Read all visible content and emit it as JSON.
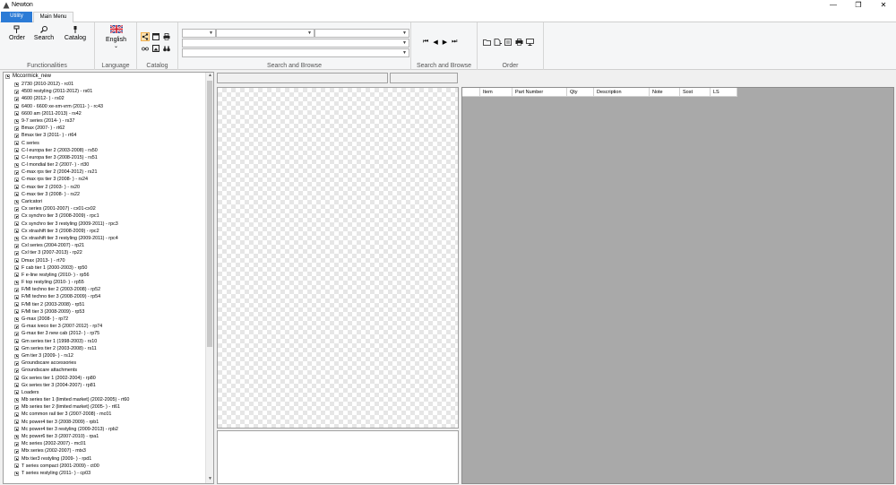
{
  "window": {
    "title": "Newton",
    "minimize": "—",
    "restore": "❐",
    "close": "✕"
  },
  "tabs": [
    {
      "label": "Utility"
    },
    {
      "label": "Main Menu"
    }
  ],
  "ribbon": {
    "functionalities": {
      "label": "Functionalities",
      "buttons": [
        {
          "label": "Order"
        },
        {
          "label": "Search"
        },
        {
          "label": "Catalog"
        }
      ]
    },
    "language": {
      "label": "Language",
      "current": "English",
      "dropdown": "⌄"
    },
    "catalog": {
      "label": "Catalog"
    },
    "search_and_browse": {
      "label": "Search and Browse",
      "combo_arrow": "▼"
    },
    "search_and_browse_nav": {
      "label": "Search and Browse",
      "first": "⏮",
      "prev": "◀",
      "next": "▶",
      "last": "⏭"
    },
    "order": {
      "label": "Order"
    }
  },
  "tree": {
    "root": "Mccormick_new",
    "items": [
      "2730 (2010-2012) - rc01",
      "4500 restyling (2011-2012) - rs01",
      "4600 (2012-    ) - rs02",
      "6400 - 6600 xe-xm-vrm (2011-    ) - rc43",
      "6600 am (2011-2013) - rs42",
      "9-7 series (2014-    ) - rs37",
      "Bmax (2007-    ) - rt62",
      "Bmax tier 3 (2011-    ) - rt64",
      "C series",
      "C-l europa tier 2 (2003-2008) - rs50",
      "C-l europa tier 3 (2008-2015) - rs51",
      "C-l mondial tier 2 (2007-    ) - rt30",
      "C-max rps tier 2 (2004-2012) - rs21",
      "C-max rps tier 3 (2008-    ) - rs24",
      "C-max tier 2 (2003-    ) - rs20",
      "C-max tier 3 (2008-    ) - rs22",
      "Caricatori",
      "Cx series (2001-2007) - cx01-cx02",
      "Cx synchro tier 3 (2008-2009) - rpc1",
      "Cx synchro tier 3 restyling (2009-2011) - rpc3",
      "Cx xtrashift tier 3 (2008-2009) - rpc2",
      "Cx xtrashift tier 3 restyling (2009-2011) - rpc4",
      "Cxl series (2004-2007) - rp21",
      "Cxl tier 3 (2007-2013) - rp22",
      "Dmax (2013-    ) - rt70",
      "F cab tier 1 (2000-2003) - rp50",
      "F e-line restyling (2010-    ) - rp56",
      "F top restyling (2010-    ) - rp55",
      "F/Ml techno tier 2 (2003-2008) - rp52",
      "F/Ml techno tier 3 (2008-2009) - rp54",
      "F/Ml tier 2 (2003-2008) - rp51",
      "F/Ml tier 3 (2008-2009) - rp53",
      "G-max (2008-    ) - rp72",
      "G-max iveco tier 3 (2007-2012) - rp74",
      "G-max tier 3 new cab (2012-    ) - rp75",
      "Gm series tier 1 (1998-2003) - rs10",
      "Gm series tier 2 (2003-2008) - rs11",
      "Gm tier 3 (2009-    ) - rs12",
      "Groundscare accessories",
      "Groundscare attachments",
      "Gx series tier 1 (2002-2004) - rp80",
      "Gx series tier 3 (2004-2007) - rp81",
      "Loaders",
      "Mb series tier 1 (limited market) (2002-2005) - rt60",
      "Mb series tier 2 (limited market) (2005-    ) - rt61",
      "Mc common rail tier 3 (2007-2008) - mc01",
      "Mc power4 tier 3 (2008-2009) - rpb1",
      "Mc power4 tier 3 restyling (2009-2013) - rpb2",
      "Mc power6 tier 3 (2007-2010) - rpa1",
      "Mc series (2002-2007) - mc01",
      "Mtx series (2002-2007) - mtx3",
      "Mtx tier3 restyling (2009-    ) - rpd1",
      "T series compact (2001-2009) - ct00",
      "T series restyling (2011-    ) - cp03"
    ]
  },
  "scroll": {
    "up": "▲",
    "down": "▼"
  },
  "grid": {
    "columns": [
      "",
      "Item",
      "Part Number",
      "Qty",
      "Description",
      "Note",
      "Sost",
      "LS"
    ]
  }
}
